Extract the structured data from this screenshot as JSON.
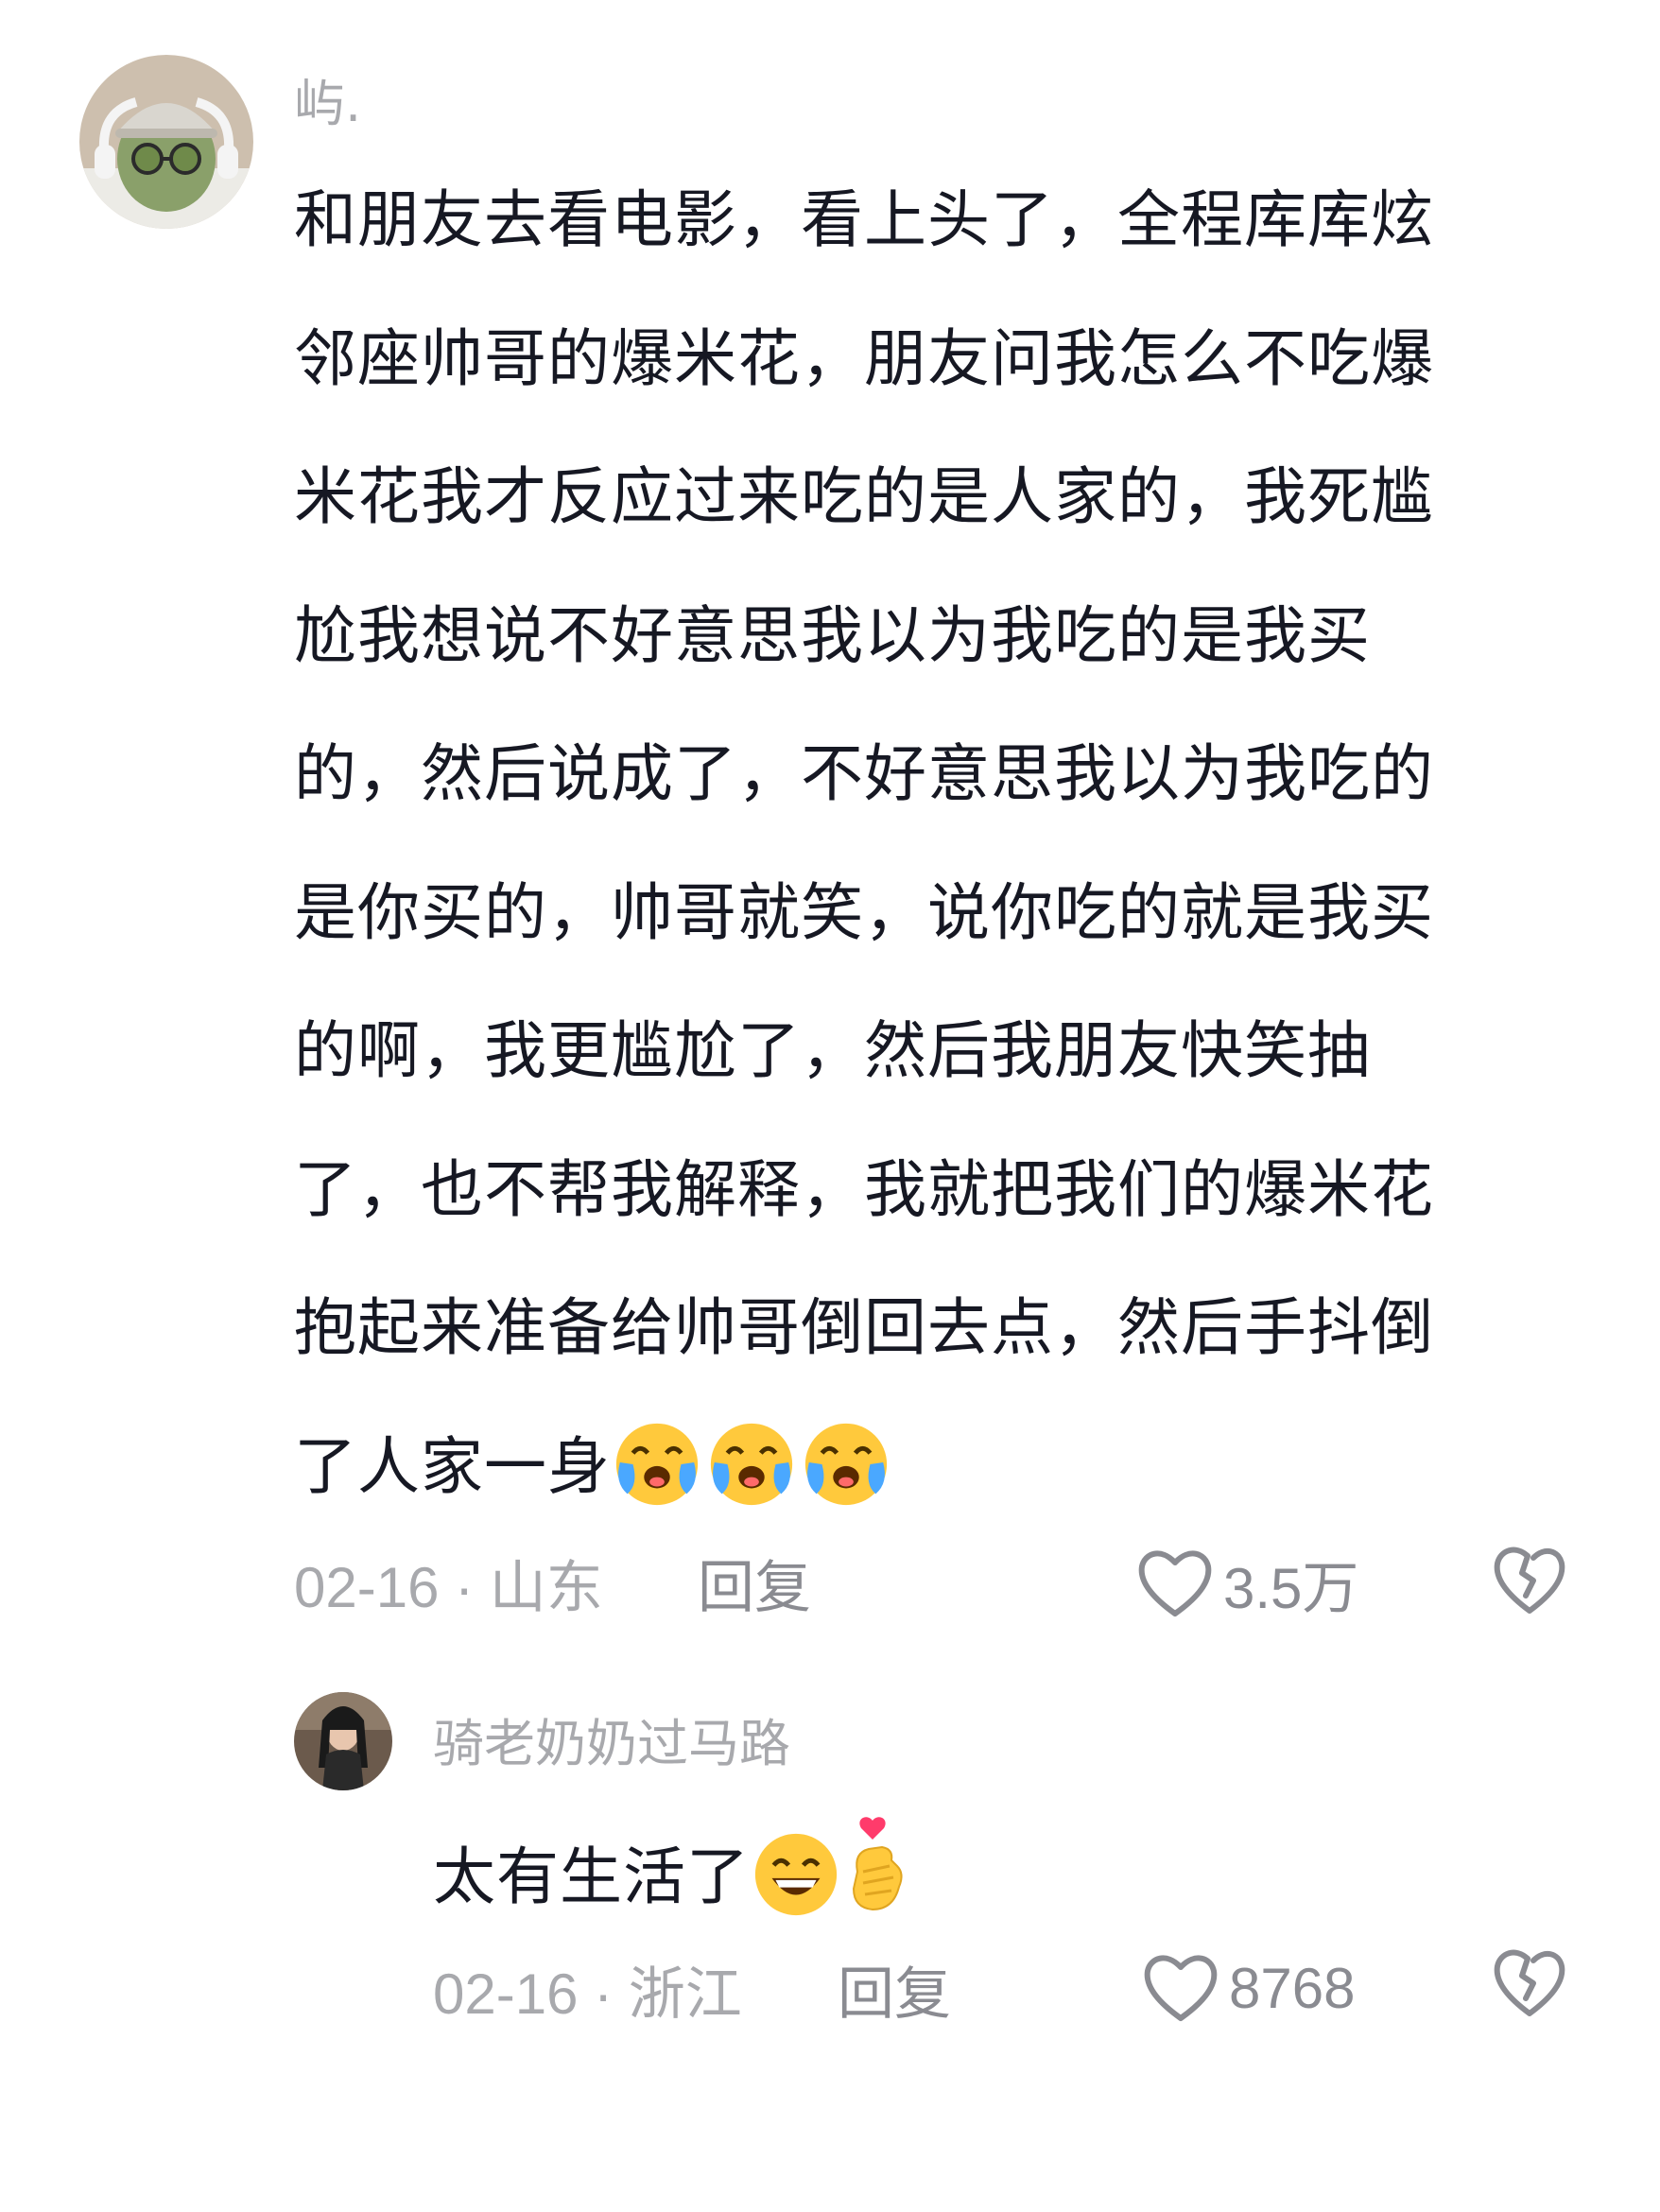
{
  "comment": {
    "username": "屿.",
    "lines": [
      "和朋友去看电影，看上头了，全程库库炫",
      "邻座帅哥的爆米花，朋友问我怎么不吃爆",
      "米花我才反应过来吃的是人家的，我死尴",
      "尬我想说不好意思我以为我吃的是我买",
      "的，然后说成了，不好意思我以为我吃的",
      "是你买的，帅哥就笑，说你吃的就是我买",
      "的啊，我更尴尬了，然后我朋友快笑抽",
      "了，也不帮我解释，我就把我们的爆米花",
      "抱起来准备给帅哥倒回去点，然后手抖倒",
      "了人家一身"
    ],
    "trailing_emojis": [
      "crying-laughing-emoji",
      "crying-laughing-emoji",
      "crying-laughing-emoji"
    ],
    "date": "02-16",
    "location": "山东",
    "separator": "·",
    "reply_label": "回复",
    "like_count": "3.5万"
  },
  "reply": {
    "username": "骑老奶奶过马路",
    "text": "太有生活了",
    "trailing_emojis": [
      "grinning-emoji",
      "finger-heart-emoji"
    ],
    "date": "02-16",
    "location": "浙江",
    "separator": "·",
    "reply_label": "回复",
    "like_count": "8768"
  },
  "colors": {
    "text": "#161823",
    "meta": "#a8a9ad",
    "action": "#8a8b91",
    "emoji_yellow": "#ffc93c",
    "emoji_tear": "#4aa8ff"
  }
}
